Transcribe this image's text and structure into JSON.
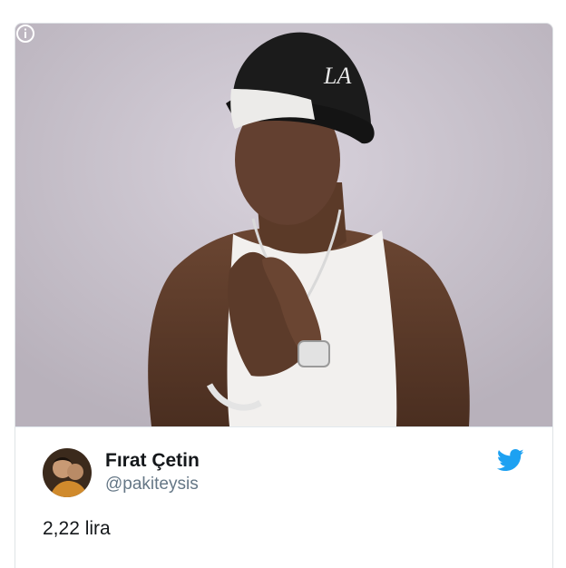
{
  "tweet": {
    "author_name": "Fırat Çetin",
    "author_handle": "@pakiteysis",
    "text": "2,22 lira"
  },
  "icons": {
    "info": "info-icon",
    "platform": "twitter-bird-icon",
    "avatar": "user-avatar"
  },
  "colors": {
    "twitter_blue": "#1da1f2",
    "name": "#14171a",
    "handle": "#657786"
  }
}
